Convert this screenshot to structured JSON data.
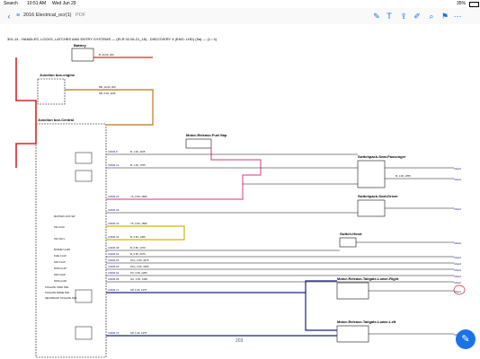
{
  "status": {
    "carrier": "Search",
    "time": "10:51 AM",
    "date": "Wed Jun 29",
    "battery": "35%"
  },
  "toolbar": {
    "title": "2016 Electrical_ocr(1)",
    "title_suffix": "PDF"
  },
  "doc": {
    "header": "301-14 - HANDLES, LOCKS, LATCHES AND ENTRY SYSTEMS — (ELR 02.06.21_18) - DISCOVERY 4 (ENG: LHD) (5a) — (1 / 4)",
    "page_label": "203"
  },
  "components": {
    "battery": "Battery",
    "jbe": "Junction box-engine",
    "jbc": "Junction box-Central",
    "motor_fuel": "Motor-Release-Fuel flap",
    "sw_passenger": "Switchpack-Seat-Passenger",
    "sw_driver": "Switchpack-Seat-Driver",
    "sw_hood": "Switch-Hood",
    "motor_tailgate_upper": "Motor-Release-Tailgate-Lower-Right",
    "motor_tailgate_lower": "Motor-Release-Tailgate-Lower-Left"
  },
  "jbc_pins": [
    "MASTER LOCK SW",
    "SW LOCK",
    "SW CAN L",
    "BONNET AJAR",
    "FUEL FLAP",
    "DRV FLAP",
    "PASS FLAP",
    "DRV AJAR",
    "PASS AJAR",
    "TAILGATE OPEN SW1",
    "TAILGATE PRIME SW1",
    "SECONDARY TAILGATE SW1"
  ],
  "wire_labels": [
    "C0006-8",
    "C0006-12",
    "C0006-20",
    "C0006-36",
    "C0006-40",
    "C0006-44",
    "C0006-48",
    "C0006-52",
    "C0006-56",
    "C0006-60",
    "C0006-64",
    "C0006-68",
    "C0006-72",
    "C0006-76"
  ],
  "wire_codes": [
    "B, 40.00, 200",
    "RB, 10.00, 200",
    "NB, 6.00, 1106",
    "B, 1.00, 1165",
    "B, 1.00, 1765",
    "YK, 0.50, 2855",
    "YK, 0.50, 1895",
    "B, 0.50, 1466",
    "B, 0.50, 1479",
    "B, 0.50, 3475",
    "PLG, 0.50, 4075",
    "PLG, 0.50, 3480",
    "PU, 0.50, 2265",
    "GU, 0.50, 1465",
    "SP, 1.00, 1475",
    "SP, 1.00, 1475",
    "B, 1.00, 1355"
  ],
  "terminals": [
    "Shield",
    "Shield",
    "Shield",
    "Shield",
    "Shield",
    "Shield",
    "Shield",
    "Shield",
    "Shield",
    "Shield",
    "Shield"
  ],
  "colors": {
    "red": "#d9262a",
    "orange": "#c98a3c",
    "pink": "#e05a9c",
    "navy": "#1a237e",
    "yellow": "#d4b400",
    "blue_accent": "#1a73e8"
  }
}
